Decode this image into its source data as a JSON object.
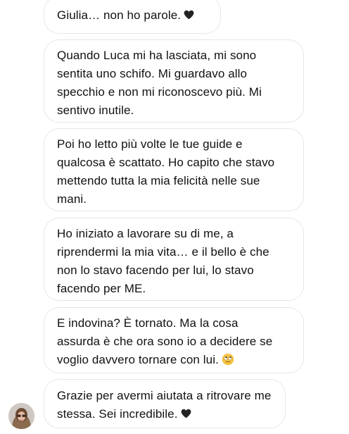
{
  "messages": [
    {
      "lines": [
        "Giulia… non ho parole."
      ],
      "trailing_icon": "black-heart-icon"
    },
    {
      "lines": [
        "Quando Luca mi ha lasciata, mi sono",
        "sentita uno schifo. Mi guardavo allo",
        "specchio e non mi riconoscevo più. Mi",
        "sentivo inutile."
      ]
    },
    {
      "lines": [
        "Poi ho letto più volte le tue guide e",
        "qualcosa è scattato. Ho capito che stavo",
        "mettendo tutta la mia felicità nelle sue",
        "mani."
      ]
    },
    {
      "lines": [
        "Ho iniziato a lavorare su di me, a",
        "riprendermi la mia vita… e il bello è che",
        "non lo stavo facendo per lui, lo stavo",
        "facendo per ME."
      ]
    },
    {
      "lines": [
        "E indovina? È tornato. Ma la cosa",
        "assurda è che ora sono io a decidere se",
        "voglio davvero tornare con lui."
      ],
      "trailing_icon": "rolling-eyes-emoji-icon"
    },
    {
      "lines": [
        "Grazie per avermi aiutata a ritrovare me",
        "stessa. Sei incredibile."
      ],
      "trailing_icon": "black-heart-icon"
    }
  ],
  "sender": {
    "avatar": "avatar"
  },
  "colors": {
    "bubble_border": "#e6e6e6",
    "text": "#111111",
    "heart": "#222222",
    "emoji": "#f6c443"
  }
}
